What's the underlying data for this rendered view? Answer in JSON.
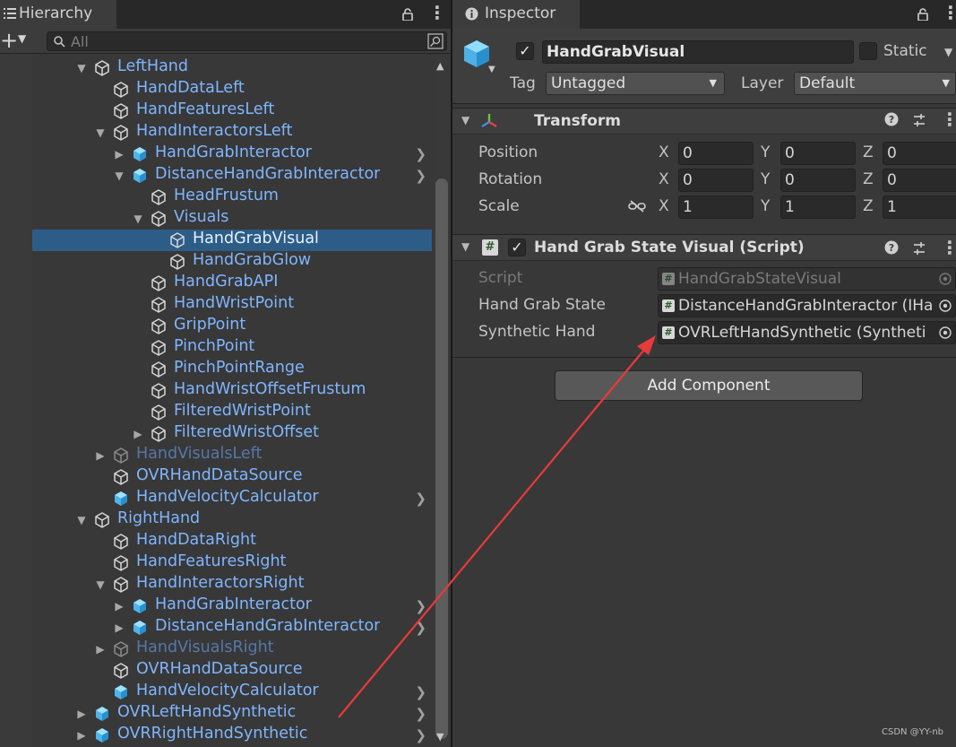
{
  "hierarchy": {
    "tab_title": "Hierarchy",
    "search_placeholder": "All",
    "rows": [
      {
        "label": "LeftHand",
        "depth": 0,
        "expander": "open",
        "icon": "cube-outline"
      },
      {
        "label": "HandDataLeft",
        "depth": 1,
        "expander": "none",
        "icon": "cube-outline"
      },
      {
        "label": "HandFeaturesLeft",
        "depth": 1,
        "expander": "none",
        "icon": "cube-outline"
      },
      {
        "label": "HandInteractorsLeft",
        "depth": 1,
        "expander": "open",
        "icon": "cube-outline"
      },
      {
        "label": "HandGrabInteractor",
        "depth": 2,
        "expander": "closed",
        "icon": "prefab-cube",
        "chevron": true
      },
      {
        "label": "DistanceHandGrabInteractor",
        "depth": 2,
        "expander": "open",
        "icon": "prefab-cube",
        "chevron": true
      },
      {
        "label": "HeadFrustum",
        "depth": 3,
        "expander": "none",
        "icon": "cube-outline"
      },
      {
        "label": "Visuals",
        "depth": 3,
        "expander": "open",
        "icon": "cube-outline"
      },
      {
        "label": "HandGrabVisual",
        "depth": 4,
        "expander": "none",
        "icon": "cube-outline",
        "selected": true
      },
      {
        "label": "HandGrabGlow",
        "depth": 4,
        "expander": "none",
        "icon": "cube-outline"
      },
      {
        "label": "HandGrabAPI",
        "depth": 3,
        "expander": "none",
        "icon": "cube-outline"
      },
      {
        "label": "HandWristPoint",
        "depth": 3,
        "expander": "none",
        "icon": "cube-outline"
      },
      {
        "label": "GripPoint",
        "depth": 3,
        "expander": "none",
        "icon": "cube-outline"
      },
      {
        "label": "PinchPoint",
        "depth": 3,
        "expander": "none",
        "icon": "cube-outline"
      },
      {
        "label": "PinchPointRange",
        "depth": 3,
        "expander": "none",
        "icon": "cube-outline"
      },
      {
        "label": "HandWristOffsetFrustum",
        "depth": 3,
        "expander": "none",
        "icon": "cube-outline"
      },
      {
        "label": "FilteredWristPoint",
        "depth": 3,
        "expander": "none",
        "icon": "cube-outline"
      },
      {
        "label": "FilteredWristOffset",
        "depth": 3,
        "expander": "closed",
        "icon": "cube-outline"
      },
      {
        "label": "HandVisualsLeft",
        "depth": 1,
        "expander": "closed",
        "icon": "cube-outline",
        "dim": true
      },
      {
        "label": "OVRHandDataSource",
        "depth": 1,
        "expander": "none",
        "icon": "cube-outline"
      },
      {
        "label": "HandVelocityCalculator",
        "depth": 1,
        "expander": "none",
        "icon": "prefab-cube",
        "chevron": true
      },
      {
        "label": "RightHand",
        "depth": 0,
        "expander": "open",
        "icon": "cube-outline"
      },
      {
        "label": "HandDataRight",
        "depth": 1,
        "expander": "none",
        "icon": "cube-outline"
      },
      {
        "label": "HandFeaturesRight",
        "depth": 1,
        "expander": "none",
        "icon": "cube-outline"
      },
      {
        "label": "HandInteractorsRight",
        "depth": 1,
        "expander": "open",
        "icon": "cube-outline"
      },
      {
        "label": "HandGrabInteractor",
        "depth": 2,
        "expander": "closed",
        "icon": "prefab-cube",
        "chevron": true
      },
      {
        "label": "DistanceHandGrabInteractor",
        "depth": 2,
        "expander": "closed",
        "icon": "prefab-cube",
        "chevron": true
      },
      {
        "label": "HandVisualsRight",
        "depth": 1,
        "expander": "closed",
        "icon": "cube-outline",
        "dim": true
      },
      {
        "label": "OVRHandDataSource",
        "depth": 1,
        "expander": "none",
        "icon": "cube-outline"
      },
      {
        "label": "HandVelocityCalculator",
        "depth": 1,
        "expander": "none",
        "icon": "prefab-cube",
        "chevron": true
      },
      {
        "label": "OVRLeftHandSynthetic",
        "depth": 0,
        "expander": "closed",
        "icon": "prefab-cube",
        "chevron": true
      },
      {
        "label": "OVRRightHandSynthetic",
        "depth": 0,
        "expander": "closed",
        "icon": "prefab-cube",
        "chevron": true
      }
    ]
  },
  "inspector": {
    "tab_title": "Inspector",
    "object_name": "HandGrabVisual",
    "static_label": "Static",
    "tag_label": "Tag",
    "tag_value": "Untagged",
    "layer_label": "Layer",
    "layer_value": "Default",
    "transform": {
      "title": "Transform",
      "rows": [
        {
          "label": "Position",
          "x": "0",
          "y": "0",
          "z": "0"
        },
        {
          "label": "Rotation",
          "x": "0",
          "y": "0",
          "z": "0"
        },
        {
          "label": "Scale",
          "x": "1",
          "y": "1",
          "z": "1"
        }
      ],
      "axis_x": "X",
      "axis_y": "Y",
      "axis_z": "Z"
    },
    "script_component": {
      "title": "Hand Grab State Visual (Script)",
      "fields": [
        {
          "label": "Script",
          "value": "HandGrabStateVisual",
          "disabled": true
        },
        {
          "label": "Hand Grab State",
          "value": "DistanceHandGrabInteractor (IHa"
        },
        {
          "label": "Synthetic Hand",
          "value": "OVRLeftHandSynthetic (Syntheti"
        }
      ]
    },
    "add_component_label": "Add Component"
  },
  "watermark": "CSDN @YY-nb",
  "colors": {
    "accent_selected": "#2c5d87",
    "tree_text": "#7fb5ff",
    "annotation_arrow": "#e83a3a"
  }
}
